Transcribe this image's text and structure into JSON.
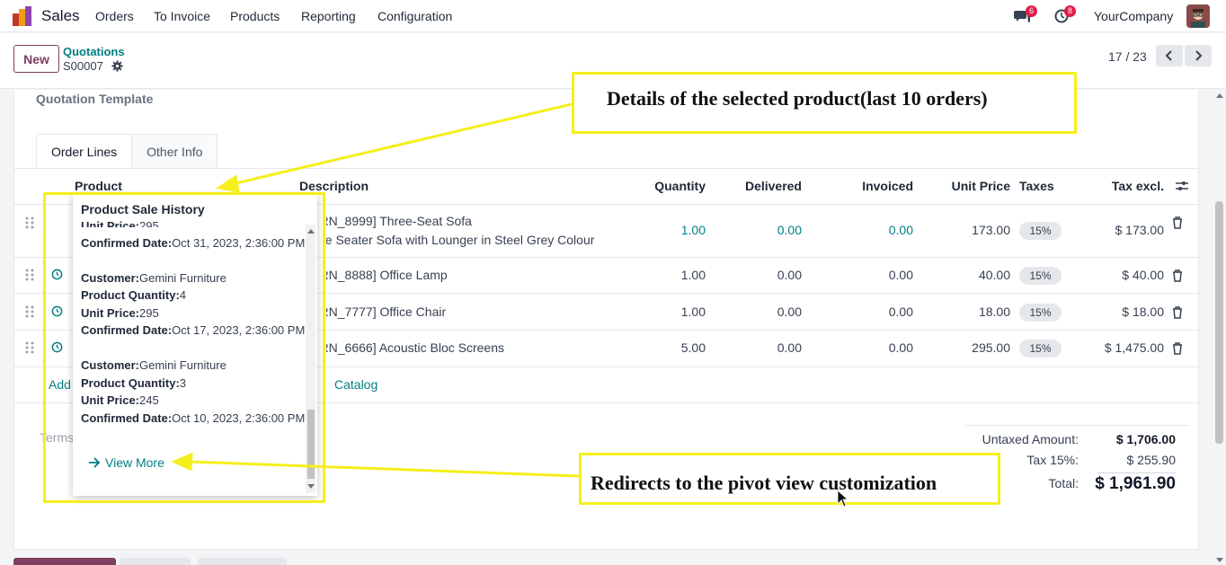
{
  "navbar": {
    "app_name": "Sales",
    "menu": [
      "Orders",
      "To Invoice",
      "Products",
      "Reporting",
      "Configuration"
    ],
    "messages_count": "6",
    "activities_count": "8",
    "company": "YourCompany"
  },
  "control": {
    "new_label": "New",
    "breadcrumb_parent": "Quotations",
    "record_name": "S00007",
    "pager": "17 / 23"
  },
  "form": {
    "quotation_template_label": "Quotation Template",
    "tabs": [
      "Order Lines",
      "Other Info"
    ],
    "columns": [
      "Product",
      "Description",
      "Quantity",
      "Delivered",
      "Invoiced",
      "Unit Price",
      "Taxes",
      "Tax excl."
    ],
    "lines": [
      {
        "description_1": "[FURN_8999] Three-Seat Sofa",
        "description_2": "Three Seater Sofa with Lounger in Steel Grey Colour",
        "quantity": "1.00",
        "delivered": "0.00",
        "invoiced": "0.00",
        "unit_price": "173.00",
        "tax": "15%",
        "subtotal": "$ 173.00"
      },
      {
        "description_1": "[FURN_8888] Office Lamp",
        "quantity": "1.00",
        "delivered": "0.00",
        "invoiced": "0.00",
        "unit_price": "40.00",
        "tax": "15%",
        "subtotal": "$ 40.00"
      },
      {
        "description_1": "[FURN_7777] Office Chair",
        "quantity": "1.00",
        "delivered": "0.00",
        "invoiced": "0.00",
        "unit_price": "18.00",
        "tax": "15%",
        "subtotal": "$ 18.00"
      },
      {
        "description_1": "[FURN_6666] Acoustic Bloc Screens",
        "quantity": "5.00",
        "delivered": "0.00",
        "invoiced": "0.00",
        "unit_price": "295.00",
        "tax": "15%",
        "subtotal": "$ 1,475.00"
      }
    ],
    "add_line": "Add a product",
    "catalog": "Catalog",
    "terms_placeholder": "Terms and conditions...",
    "totals": {
      "untaxed_label": "Untaxed Amount:",
      "untaxed_value": "$ 1,706.00",
      "tax_label": "Tax 15%:",
      "tax_value": "$ 255.90",
      "total_label": "Total:",
      "total_value": "$ 1,961.90"
    }
  },
  "popover": {
    "title": "Product Sale History",
    "partial_unit_price_label": "Unit Price:",
    "partial_unit_price": "295",
    "entries": [
      {
        "confirmed_label": "Confirmed Date:",
        "confirmed": "Oct 31, 2023, 2:36:00 PM"
      },
      {
        "customer_label": "Customer:",
        "customer": "Gemini Furniture",
        "qty_label": "Product Quantity:",
        "qty": "4",
        "price_label": "Unit Price:",
        "price": "295",
        "confirmed_label": "Confirmed Date:",
        "confirmed": "Oct 17, 2023, 2:36:00 PM"
      },
      {
        "customer_label": "Customer:",
        "customer": "Gemini Furniture",
        "qty_label": "Product Quantity:",
        "qty": "3",
        "price_label": "Unit Price:",
        "price": "245",
        "confirmed_label": "Confirmed Date:",
        "confirmed": "Oct 10, 2023, 2:36:00 PM"
      }
    ],
    "view_more": "View More"
  },
  "annotations": {
    "top_callout": "Details of the selected product(last 10 orders)",
    "bottom_callout": "Redirects to the pivot view customization",
    "highlight_color": "#f5ef1c"
  },
  "colors": {
    "brand": "#7c3f5e",
    "teal": "#017e84",
    "badge": "#e11d48"
  }
}
